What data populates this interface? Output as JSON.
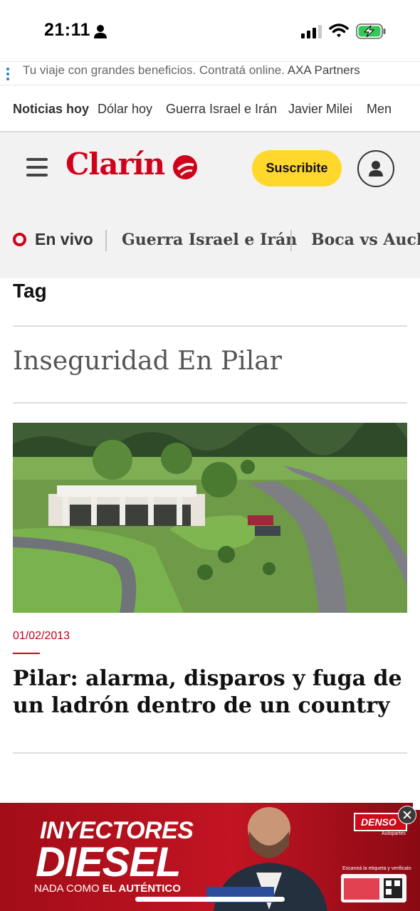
{
  "status_bar": {
    "time": "21:11"
  },
  "top_ad": {
    "text": "Tu viaje con grandes beneficios. Contratá online.",
    "brand": "AXA Partners"
  },
  "trending": {
    "title": "Noticias hoy",
    "items": [
      "Dólar hoy",
      "Guerra Israel e Irán",
      "Javier Milei",
      "Men"
    ]
  },
  "header": {
    "logo": "Clarín",
    "subscribe_label": "Suscribite"
  },
  "sections": {
    "live_label": "En vivo",
    "items": [
      "Guerra Israel e Irán",
      "Boca vs Auckl"
    ]
  },
  "page": {
    "tag_label": "Tag",
    "tag_title": "Inseguridad En Pilar"
  },
  "article": {
    "date": "01/02/2013",
    "title": "Pilar: alarma, disparos y fuga de un ladrón dentro de un country"
  },
  "bottom_ad": {
    "line1": "INYECTORES",
    "line2": "DIESEL",
    "line3_prefix": "NADA COMO ",
    "line3_bold": "EL AUTÉNTICO",
    "brand": "DENSO",
    "brand_sub": "Autopartes",
    "scan_text": "Escaneá la etiqueta y verificalo"
  },
  "colors": {
    "brand_red": "#d0021b",
    "subscribe_yellow": "#ffd82b",
    "header_bg": "#f2f2f2"
  }
}
